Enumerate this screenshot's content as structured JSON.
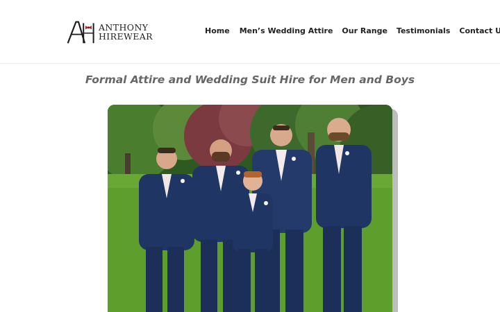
{
  "logo": {
    "line1": "ANTHONY",
    "line2": "HIREWEAR",
    "monogram_icon": "ah-monogram-bowtie-icon"
  },
  "nav": {
    "items": [
      {
        "label": "Home"
      },
      {
        "label": "Men’s Wedding Attire"
      },
      {
        "label": "Our Range"
      },
      {
        "label": "Testimonials"
      },
      {
        "label": "Contact Us"
      }
    ]
  },
  "main": {
    "headline": "Formal Attire and Wedding Suit Hire for Men and Boys"
  },
  "colors": {
    "nav_text": "#222222",
    "headline": "#666666",
    "suit_navy": "#1f3563",
    "grass": "#5a9a2a"
  }
}
